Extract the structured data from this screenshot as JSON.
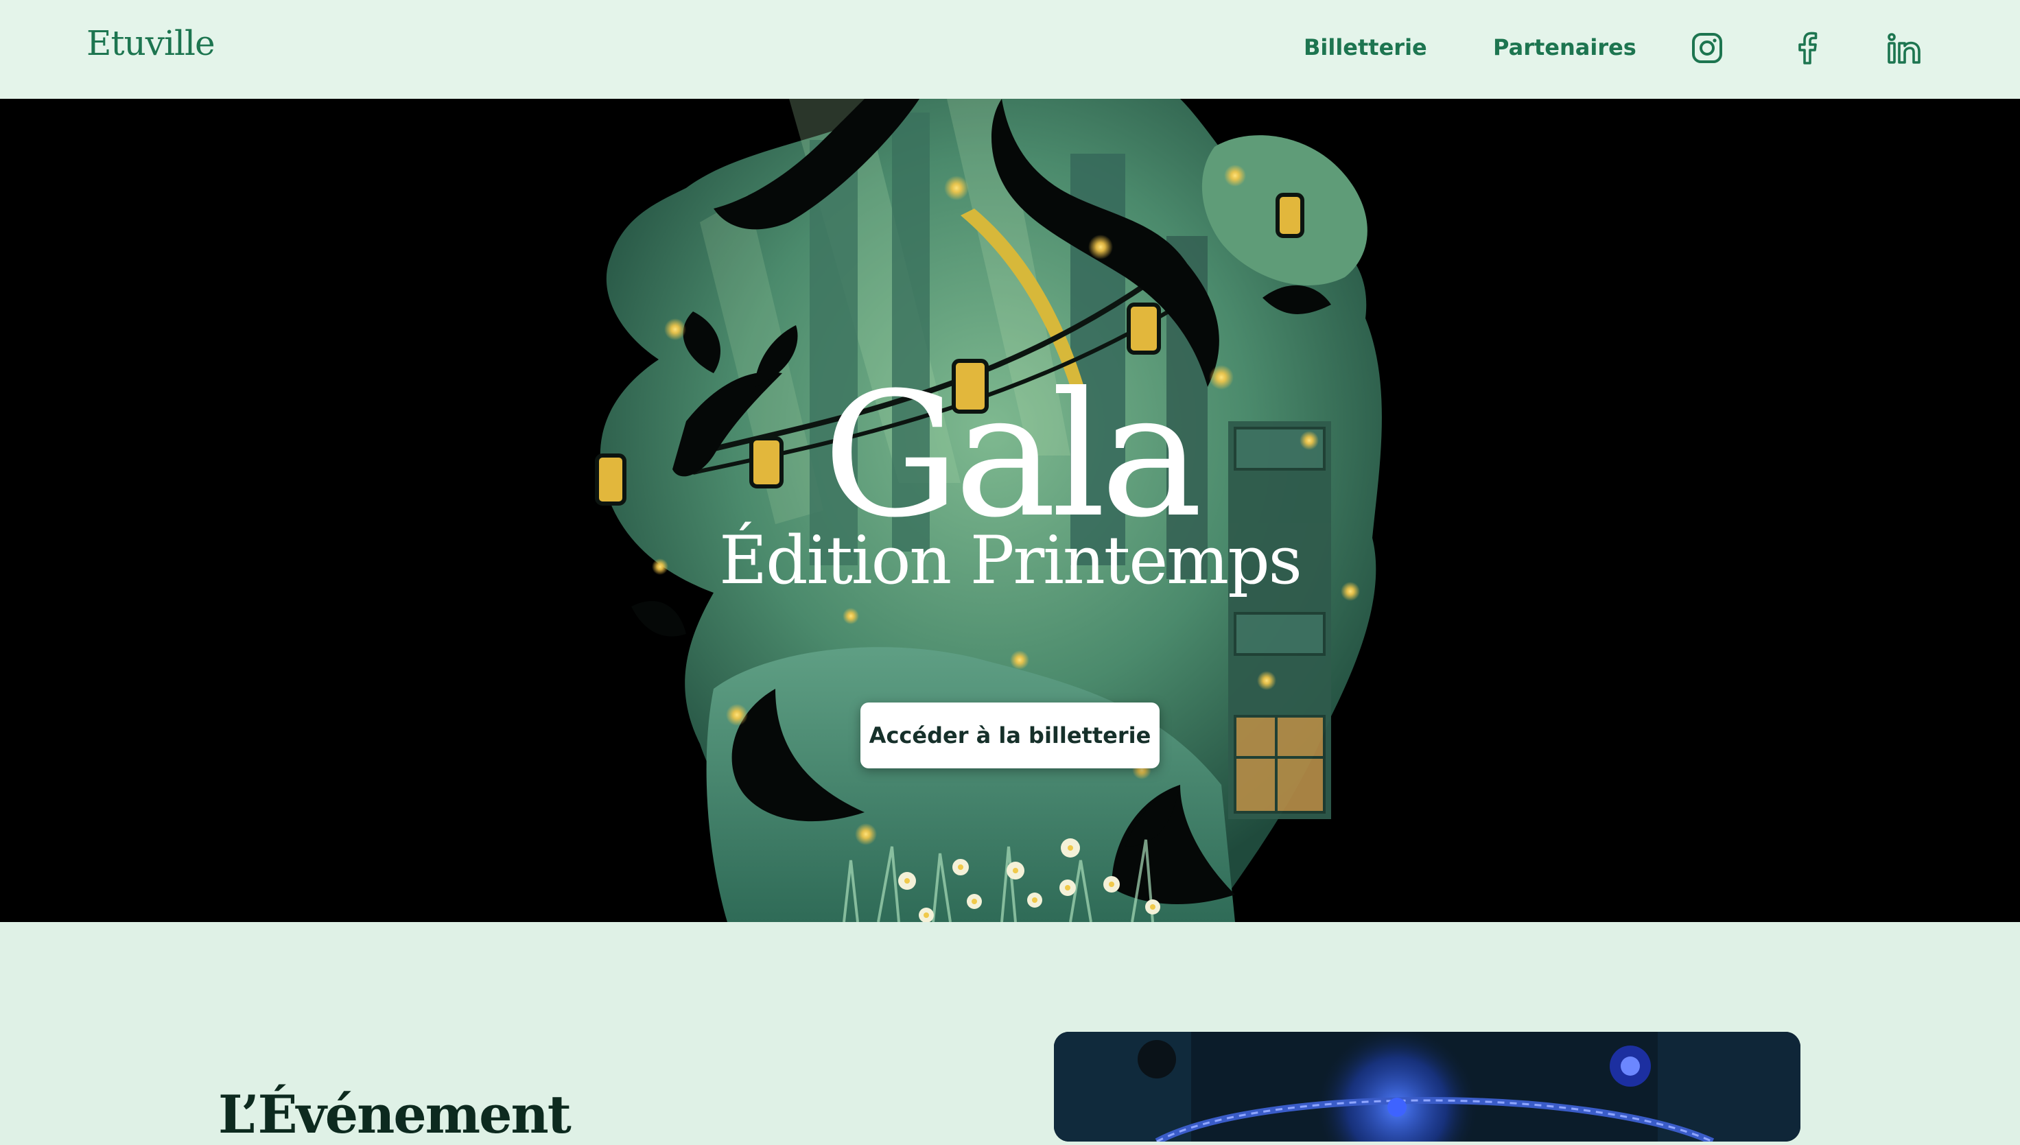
{
  "header": {
    "logo": "Etuville",
    "nav": [
      {
        "label": "Billetterie"
      },
      {
        "label": "Partenaires"
      }
    ],
    "social": [
      {
        "icon": "instagram-icon"
      },
      {
        "icon": "facebook-icon"
      },
      {
        "icon": "linkedin-icon"
      }
    ]
  },
  "hero": {
    "title": "Gala",
    "subtitle": "Édition Printemps",
    "cta_label": "Accéder à la billetterie"
  },
  "event_section": {
    "title": "L’Événement"
  },
  "colors": {
    "brand_green": "#1d7550",
    "page_background": "#dff1e6",
    "hero_background": "#000000",
    "firefly": "#f6c84a"
  }
}
